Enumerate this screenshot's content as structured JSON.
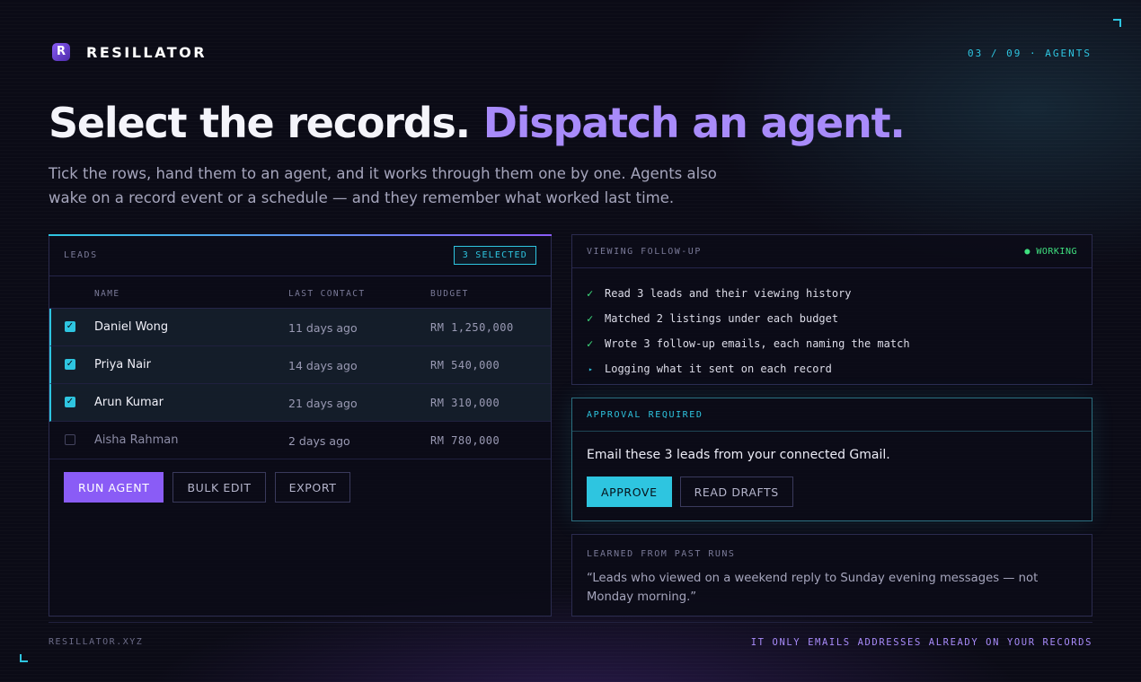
{
  "brand": {
    "logo_letter": "R",
    "name": "RESILLATOR"
  },
  "pager": "03 / 09 · AGENTS",
  "headline": {
    "part1": "Select the records.",
    "part2": "Dispatch an agent."
  },
  "lede": "Tick the rows, hand them to an agent, and it works through them one by one. Agents also wake on a record event or a schedule — and they remember what worked last time.",
  "leads_panel": {
    "title": "LEADS",
    "selected_badge": "3 SELECTED",
    "columns": {
      "name": "NAME",
      "last_contact": "LAST CONTACT",
      "budget": "BUDGET"
    },
    "rows": [
      {
        "name": "Daniel Wong",
        "last_contact": "11 days ago",
        "budget": "RM 1,250,000",
        "selected": true
      },
      {
        "name": "Priya Nair",
        "last_contact": "14 days ago",
        "budget": "RM 540,000",
        "selected": true
      },
      {
        "name": "Arun Kumar",
        "last_contact": "21 days ago",
        "budget": "RM 310,000",
        "selected": true
      },
      {
        "name": "Aisha Rahman",
        "last_contact": "2 days ago",
        "budget": "RM 780,000",
        "selected": false
      }
    ],
    "actions": {
      "run": "RUN AGENT",
      "bulk_edit": "BULK EDIT",
      "export": "EXPORT"
    }
  },
  "task_panel": {
    "title": "VIEWING FOLLOW-UP",
    "status": "● WORKING",
    "steps": [
      {
        "mark": "✓",
        "text": "Read 3 leads and their viewing history"
      },
      {
        "mark": "✓",
        "text": "Matched 2 listings under each budget"
      },
      {
        "mark": "✓",
        "text": "Wrote 3 follow-up emails, each naming the match"
      },
      {
        "mark": "▸",
        "text": "Logging what it sent on each record"
      }
    ]
  },
  "approval": {
    "title": "APPROVAL REQUIRED",
    "text": "Email these 3 leads from your connected Gmail.",
    "approve": "APPROVE",
    "read_drafts": "READ DRAFTS"
  },
  "learned": {
    "title": "LEARNED FROM PAST RUNS",
    "quote": "“Leads who viewed on a weekend reply to Sunday evening messages — not Monday morning.”"
  },
  "footer": {
    "left": "RESILLATOR.XYZ",
    "right": "IT ONLY EMAILS ADDRESSES ALREADY ON YOUR RECORDS"
  },
  "colors": {
    "accent_purple": "#8a5cf6",
    "accent_cyan": "#2ec5e0",
    "status_green": "#3fe07f",
    "background": "#0b0b16"
  }
}
